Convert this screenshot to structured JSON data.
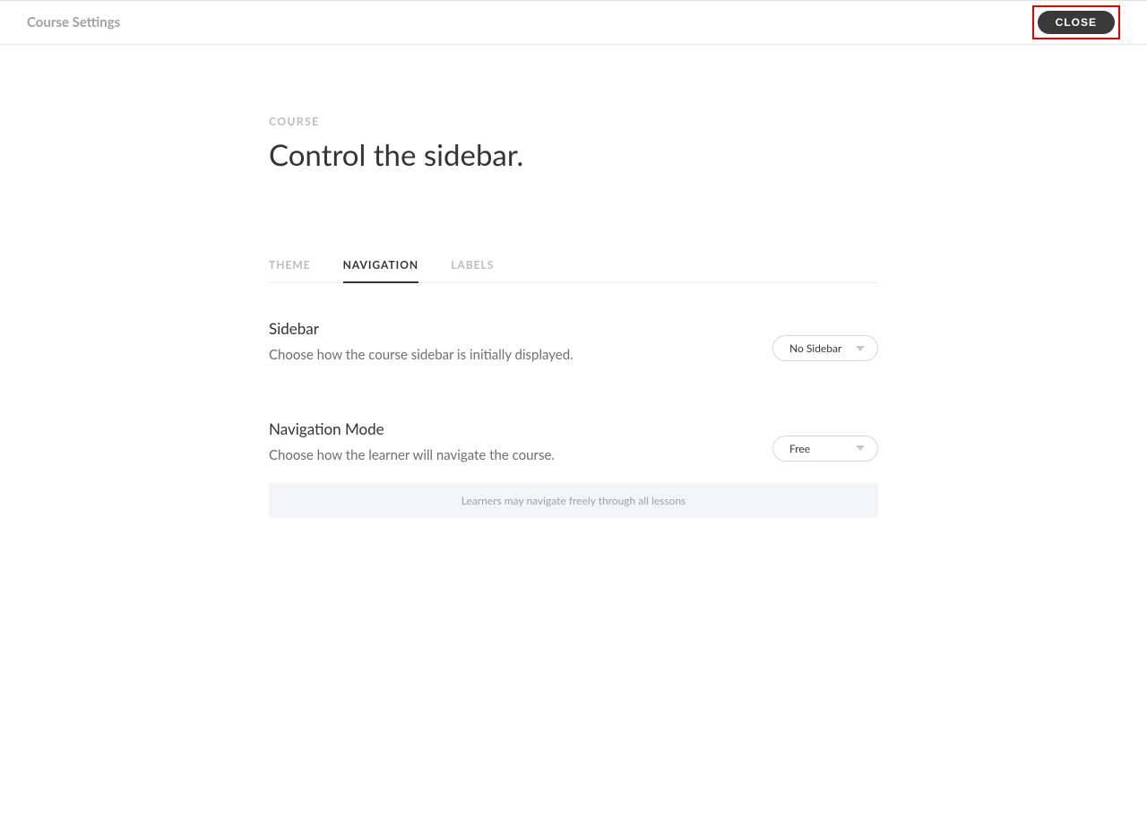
{
  "topbar": {
    "title": "Course Settings",
    "close_label": "CLOSE"
  },
  "header": {
    "eyebrow": "COURSE",
    "title": "Control the sidebar."
  },
  "tabs": {
    "theme": "THEME",
    "navigation": "NAVIGATION",
    "labels": "LABELS"
  },
  "sections": {
    "sidebar": {
      "heading": "Sidebar",
      "desc": "Choose how the course sidebar is initially displayed.",
      "selected": "No Sidebar"
    },
    "navmode": {
      "heading": "Navigation Mode",
      "desc": "Choose how the learner will navigate the course.",
      "selected": "Free",
      "info": "Learners may navigate freely through all lessons"
    }
  }
}
